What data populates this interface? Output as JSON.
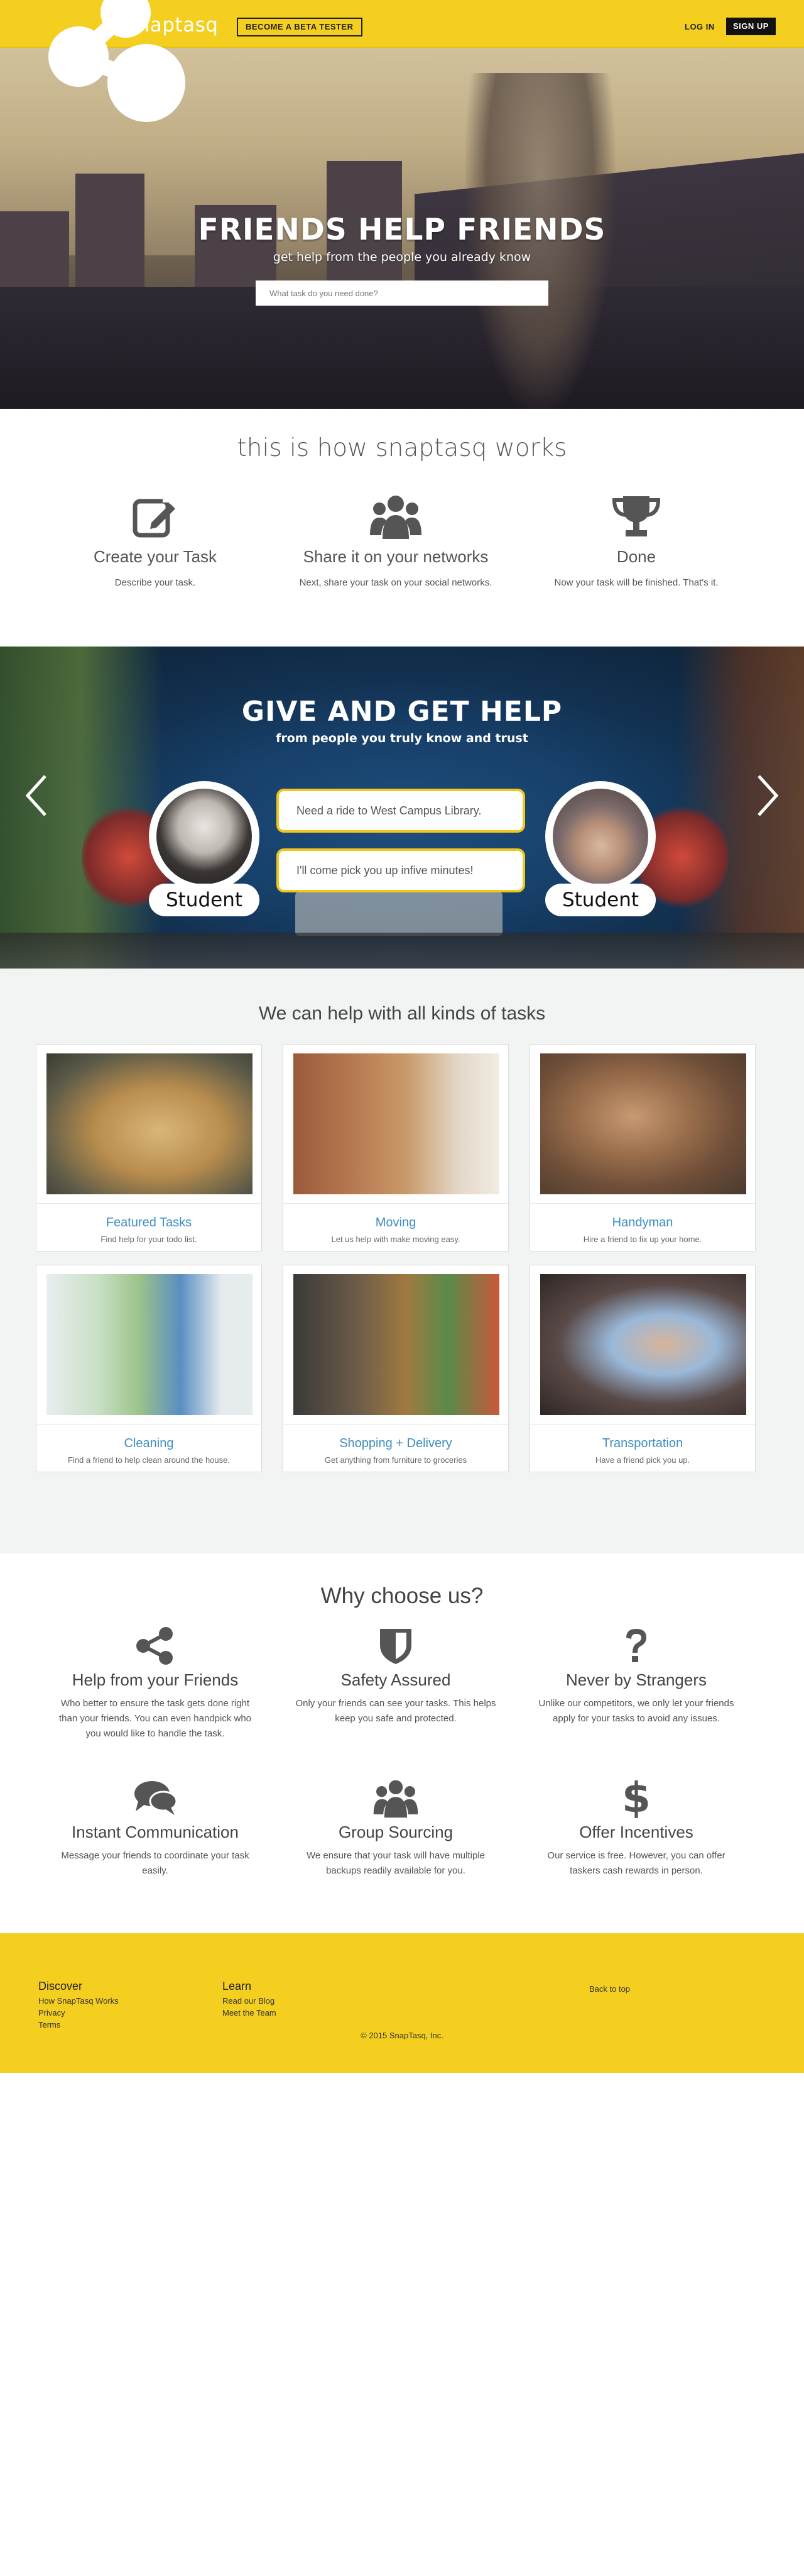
{
  "nav": {
    "brand": "snaptasq",
    "beta_label": "BECOME A BETA TESTER",
    "login_label": "LOG IN",
    "signup_label": "SIGN UP"
  },
  "hero": {
    "title": "FRIENDS HELP FRIENDS",
    "subtitle": "get help from the people you already know",
    "search_placeholder": "What task do you need done?"
  },
  "how": {
    "title": "this is how snaptasq works",
    "steps": [
      {
        "icon": "edit-icon",
        "title": "Create your Task",
        "text": "Describe your task."
      },
      {
        "icon": "users-icon",
        "title": "Share it on your networks",
        "text": "Next, share your task on your social networks."
      },
      {
        "icon": "trophy-icon",
        "title": "Done",
        "text": "Now your task will be finished. That's it."
      }
    ]
  },
  "slider": {
    "title": "GIVE AND GET HELP",
    "subtitle": "from people you truly know and trust",
    "left_badge": "Student",
    "right_badge": "Student",
    "message_1": "Need a ride to West Campus Library.",
    "message_2": "I'll come pick you up infive minutes!"
  },
  "tasks": {
    "title": "We can help with all kinds of tasks",
    "items": [
      {
        "title": "Featured Tasks",
        "text": "Find help for your todo list."
      },
      {
        "title": "Moving",
        "text": "Let us help with make moving easy."
      },
      {
        "title": "Handyman",
        "text": "Hire a friend to fix up your home."
      },
      {
        "title": "Cleaning",
        "text": "Find a friend to help clean around the house."
      },
      {
        "title": "Shopping + Delivery",
        "text": "Get anything from furniture to groceries"
      },
      {
        "title": "Transportation",
        "text": "Have a friend pick you up."
      }
    ]
  },
  "why": {
    "title": "Why choose us?",
    "items": [
      {
        "icon": "share-icon",
        "title": "Help from your Friends",
        "text": "Who better to ensure the task gets done right than your friends. You can even handpick who you would like to handle the task."
      },
      {
        "icon": "shield-icon",
        "title": "Safety Assured",
        "text": "Only your friends can see your tasks. This helps keep you safe and protected."
      },
      {
        "icon": "question-icon",
        "title": "Never by Strangers",
        "text": "Unlike our competitors, we only let your friends apply for your tasks to avoid any issues."
      },
      {
        "icon": "chat-icon",
        "title": "Instant Communication",
        "text": "Message your friends to coordinate your task easily."
      },
      {
        "icon": "users-icon",
        "title": "Group Sourcing",
        "text": "We ensure that your task will have multiple backups readily available for you."
      },
      {
        "icon": "dollar-icon",
        "title": "Offer Incentives",
        "text": "Our service is free. However, you can offer taskers cash rewards in person."
      }
    ]
  },
  "footer": {
    "discover_heading": "Discover",
    "discover_links": [
      "How SnapTasq Works",
      "Privacy",
      "Terms"
    ],
    "learn_heading": "Learn",
    "learn_links": [
      "Read our Blog",
      "Meet the Team"
    ],
    "back_to_top": "Back to top",
    "copyright": "© 2015 SnapTasq, Inc."
  }
}
